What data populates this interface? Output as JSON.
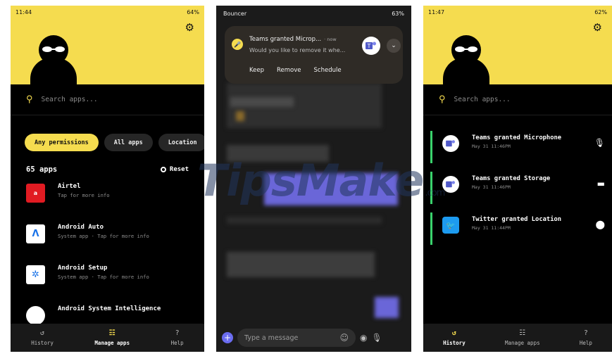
{
  "left_phone": {
    "status": {
      "time": "11:44",
      "battery": "64%"
    },
    "search_placeholder": "Search apps...",
    "chips": [
      "Any permissions",
      "All apps",
      "Location"
    ],
    "count": "65 apps",
    "reset": "Reset",
    "apps": [
      {
        "name": "Airtel",
        "sub": "Tap for more info",
        "icon": "airtel-logo"
      },
      {
        "name": "Android Auto",
        "sub": "System app · Tap for more info",
        "icon": "android-auto-logo"
      },
      {
        "name": "Android Setup",
        "sub": "System app · Tap for more info",
        "icon": "gear-icon"
      },
      {
        "name": "Android System Intelligence",
        "sub": "",
        "icon": "circle-icon"
      }
    ],
    "nav": [
      {
        "label": "History",
        "icon": "history-icon",
        "active": false
      },
      {
        "label": "Manage apps",
        "icon": "grid-icon",
        "active": true
      },
      {
        "label": "Help",
        "icon": "help-icon",
        "active": false
      }
    ]
  },
  "middle_phone": {
    "status": {
      "app": "Bouncer",
      "battery": "63%"
    },
    "notification": {
      "title": "Teams granted Microp...",
      "time": "· now",
      "body": "Would you like to remove it whe...",
      "actions": [
        "Keep",
        "Remove",
        "Schedule"
      ]
    },
    "compose_placeholder": "Type a message"
  },
  "right_phone": {
    "status": {
      "time": "11:47",
      "battery": "62%"
    },
    "search_placeholder": "Search apps...",
    "history": [
      {
        "title": "Teams granted Microphone",
        "date": "May 31 11:46PM",
        "app_icon": "teams-icon",
        "perm_icon": "microphone-icon"
      },
      {
        "title": "Teams granted Storage",
        "date": "May 31 11:46PM",
        "app_icon": "teams-icon",
        "perm_icon": "folder-icon"
      },
      {
        "title": "Twitter granted Location",
        "date": "May 31 11:44PM",
        "app_icon": "twitter-icon",
        "perm_icon": "location-pin-icon"
      }
    ],
    "nav": [
      {
        "label": "History",
        "icon": "history-icon",
        "active": true
      },
      {
        "label": "Manage apps",
        "icon": "grid-icon",
        "active": false
      },
      {
        "label": "Help",
        "icon": "help-icon",
        "active": false
      }
    ]
  },
  "watermark": {
    "text": "TipsMake",
    "suffix": ".com"
  },
  "colors": {
    "accent": "#f5dc4f",
    "green_bar": "#3ad26c",
    "background": "#000000"
  }
}
